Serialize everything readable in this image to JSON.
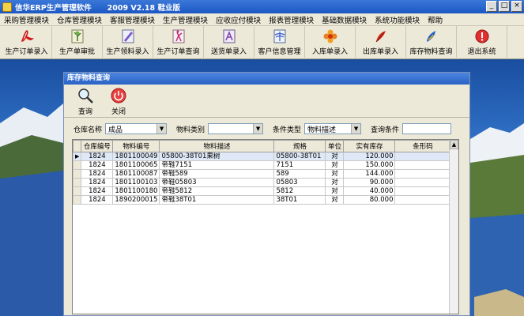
{
  "window": {
    "title": "信华ERP生产管理软件      2009 V2.18 鞋业版",
    "buttons": [
      "_",
      "□",
      "×"
    ]
  },
  "menubar": {
    "items": [
      "采购管理模块",
      "仓库管理模块",
      "客服管理模块",
      "生产管理模块",
      "应收应付模块",
      "报表管理模块",
      "基础数据模块",
      "系统功能模块",
      "帮助"
    ]
  },
  "toolbar": {
    "items": [
      {
        "label": "生产订单录入",
        "icon": "pdf-icon"
      },
      {
        "label": "生产单审批",
        "icon": "tree-icon"
      },
      {
        "label": "生产领料录入",
        "icon": "pen-icon"
      },
      {
        "label": "生产订单查询",
        "icon": "dancer-icon"
      },
      {
        "label": "送货单录入",
        "icon": "compass-icon"
      },
      {
        "label": "客户信息管理",
        "icon": "dragonfly-icon"
      },
      {
        "label": "入库单录入",
        "icon": "flower-icon"
      },
      {
        "label": "出库单录入",
        "icon": "feather-icon"
      },
      {
        "label": "库存物料查询",
        "icon": "quill-icon"
      },
      {
        "label": "退出系统",
        "icon": "exit-icon"
      }
    ]
  },
  "inner": {
    "title": "库存物料查询",
    "query_label": "查询",
    "close_label": "关闭",
    "filter": {
      "warehouse_label": "仓库名称",
      "warehouse_value": "成品",
      "category_label": "物料类别",
      "category_value": "",
      "condition_type_label": "条件类型",
      "condition_type_value": "物料描述",
      "condition_label": "查询条件"
    },
    "table": {
      "headers": [
        "仓库编号",
        "物料编号",
        "物料描述",
        "规格",
        "单位",
        "实有库存",
        "条形码"
      ],
      "rows": [
        [
          "1824",
          "1801100049",
          "05800-38T01果树",
          "05800-38T01",
          "对",
          "120.000",
          ""
        ],
        [
          "1824",
          "1801100065",
          "帝鞋7151",
          "7151",
          "对",
          "150.000",
          ""
        ],
        [
          "1824",
          "1801100087",
          "帝鞋589",
          "589",
          "对",
          "144.000",
          ""
        ],
        [
          "1824",
          "1801100103",
          "帝鞋05803",
          "05803",
          "对",
          "90.000",
          ""
        ],
        [
          "1824",
          "1801100180",
          "帝鞋5812",
          "5812",
          "对",
          "40.000",
          ""
        ],
        [
          "1824",
          "1890200015",
          "帝鞋38T01",
          "38T01",
          "对",
          "80.000",
          ""
        ]
      ]
    }
  }
}
